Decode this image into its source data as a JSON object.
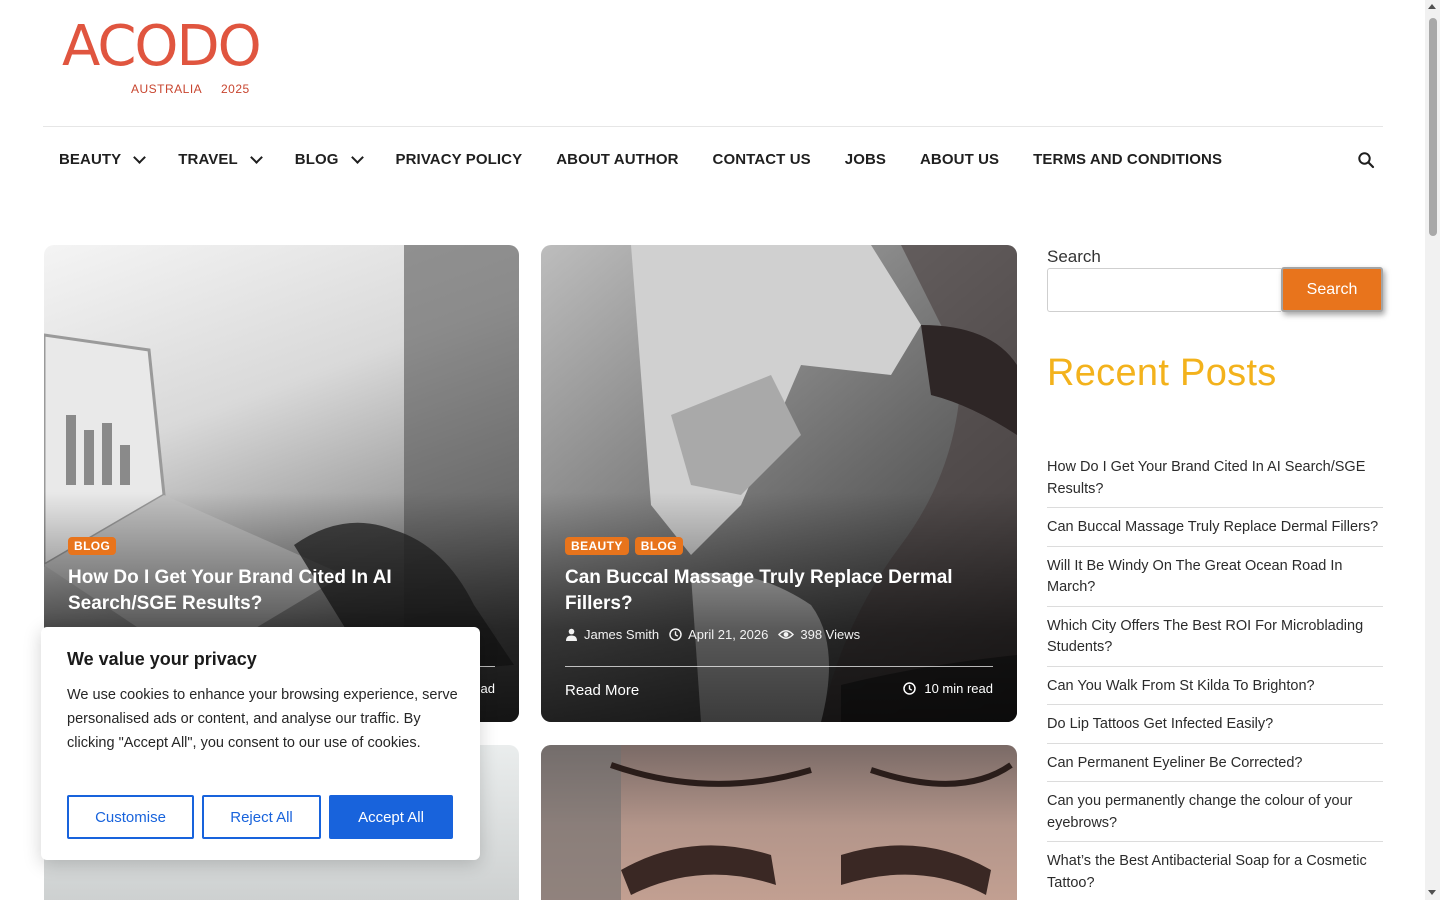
{
  "logo": {
    "word": "ACODO",
    "sub": "AUSTRALIA",
    "year": "2025"
  },
  "nav": {
    "items": [
      {
        "label": "BEAUTY",
        "dropdown": true
      },
      {
        "label": "TRAVEL",
        "dropdown": true
      },
      {
        "label": "BLOG",
        "dropdown": true
      },
      {
        "label": "PRIVACY POLICY"
      },
      {
        "label": "ABOUT AUTHOR"
      },
      {
        "label": "CONTACT US"
      },
      {
        "label": "JOBS"
      },
      {
        "label": "ABOUT US"
      },
      {
        "label": "TERMS AND CONDITIONS"
      }
    ],
    "search_icon": "search-icon"
  },
  "cards": [
    {
      "categories": [
        "BLOG"
      ],
      "title": "How Do I Get Your Brand Cited In AI Search/SGE Results?",
      "read_time_partial": "ad"
    },
    {
      "categories": [
        "BEAUTY",
        "BLOG"
      ],
      "title": "Can Buccal Massage Truly Replace Dermal Fillers?",
      "author": "James Smith",
      "date": "April 21, 2026",
      "views": "398 Views",
      "read_more": "Read More",
      "read_time": "10 min read"
    }
  ],
  "sidebar": {
    "search_label": "Search",
    "search_button": "Search",
    "search_value": "",
    "recent_heading": "Recent Posts",
    "recent_posts": [
      "How Do I Get Your Brand Cited In AI Search/SGE Results?",
      "Can Buccal Massage Truly Replace Dermal Fillers?",
      "Will It Be Windy On The Great Ocean Road In March?",
      "Which City Offers The Best ROI For Microblading Students?",
      "Can You Walk From St Kilda To Brighton?",
      "Do Lip Tattoos Get Infected Easily?",
      "Can Permanent Eyeliner Be Corrected?",
      "Can you permanently change the colour of your eyebrows?",
      "What’s the Best Antibacterial Soap for a Cosmetic Tattoo?"
    ]
  },
  "cookie": {
    "title": "We value your privacy",
    "body": "We use cookies to enhance your browsing experience, serve personalised ads or content, and analyse our traffic. By clicking \"Accept All\", you consent to our use of cookies.",
    "customise": "Customise",
    "reject": "Reject All",
    "accept": "Accept All"
  },
  "colors": {
    "brand": "#e0553f",
    "accent": "#e8741c",
    "heading": "#f3b21c",
    "cookie_primary": "#1863dc"
  }
}
